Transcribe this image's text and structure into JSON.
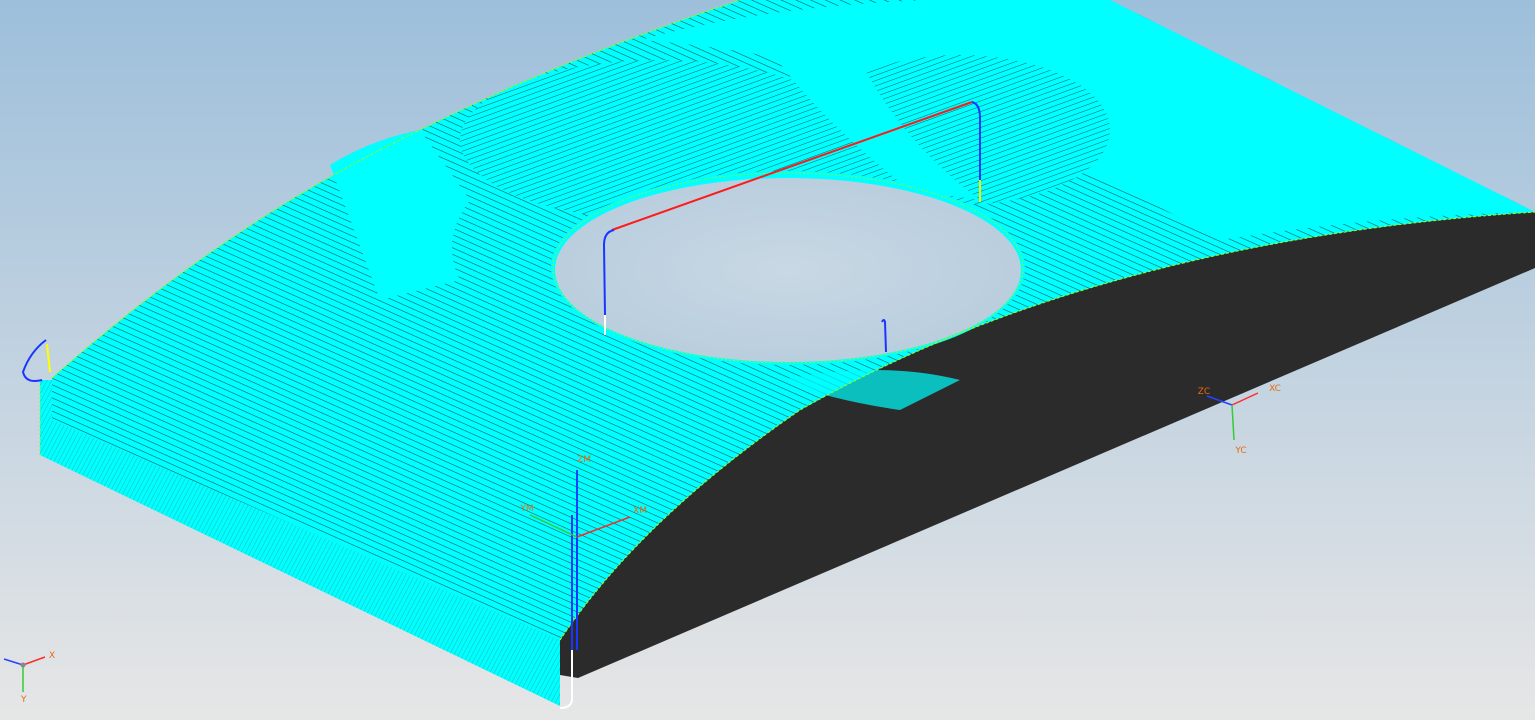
{
  "viewport": {
    "background_top": "#9dbfdb",
    "background_bottom": "#e6e6e6"
  },
  "colors": {
    "toolpath": "#00ffff",
    "toolpath_shadow": "#0b4f4f",
    "part_solid": "#2b2b2b",
    "edge_highlight": "#7cff3a",
    "rapid_move": "#ff1a1a",
    "engage_move": "#1a35ff",
    "retract_move": "#ffff00",
    "departure_move": "#ffffff",
    "axis_x": "#ff2b2b",
    "axis_y": "#33cc33",
    "axis_z": "#2244ff",
    "axis_label": "#e86a10"
  },
  "wcs": {
    "x_label": "XC",
    "y_label": "YC",
    "z_label": "ZC",
    "icon": "wcs-triad-icon"
  },
  "mcs": {
    "x_label": "XM",
    "y_label": "YM",
    "z_label": "ZM",
    "icon": "mcs-triad-icon"
  },
  "absolute_triad": {
    "x_label": "X",
    "y_label": "Y",
    "icon": "absolute-csys-triad-icon"
  }
}
